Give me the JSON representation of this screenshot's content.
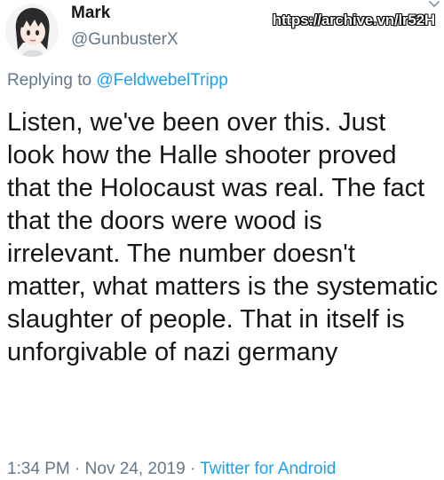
{
  "author": {
    "display_name": "Mark",
    "handle": "@GunbusterX"
  },
  "overlay": {
    "archive_url": "https://archive.vn/lr52H"
  },
  "reply": {
    "prefix": "Replying to",
    "mention": "@FeldwebelTripp"
  },
  "tweet": {
    "text": "Listen, we've been over this. Just look how the Halle shooter proved that the Holocaust was real. The fact that the doors were wood is irrelevant. The number doesn't matter, what matters is the systematic slaughter of people. That in itself is unforgivable of nazi germany"
  },
  "meta": {
    "time": "1:34 PM",
    "separator1": "·",
    "date": "Nov 24, 2019",
    "separator2": "·",
    "source": "Twitter for Android"
  },
  "icons": {
    "avatar": "anime-girl-avatar",
    "menu": "chevron-down-icon"
  },
  "colors": {
    "text": "#14171a",
    "muted": "#657786",
    "link": "#1da1f2"
  }
}
